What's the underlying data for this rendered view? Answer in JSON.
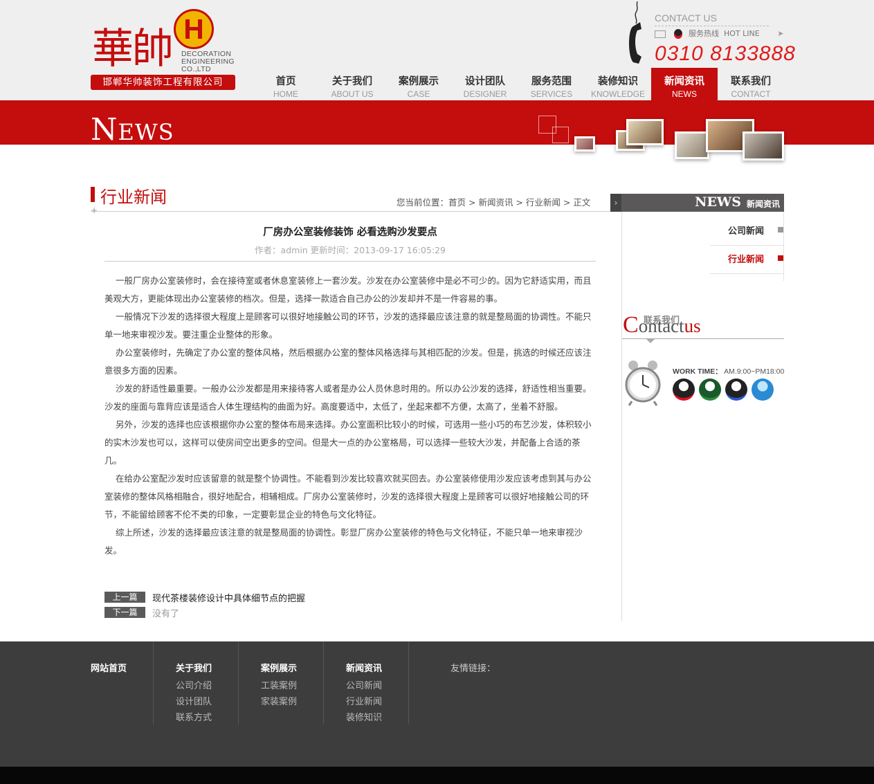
{
  "header": {
    "logo_char": "華帥",
    "logo_en": [
      "DECORATION",
      "ENGINEERING",
      "CO.,LTD"
    ],
    "company_name": "邯郸华帅装饰工程有限公司",
    "contact_label": "CONTACT",
    "contact_label_suffix": "US",
    "hotline_cn": "服务热线",
    "hotline_en": "HOT LINE",
    "phone": "0310 8133888"
  },
  "nav": [
    {
      "cn": "首页",
      "en": "HOME"
    },
    {
      "cn": "关于我们",
      "en": "ABOUT US"
    },
    {
      "cn": "案例展示",
      "en": "CASE"
    },
    {
      "cn": "设计团队",
      "en": "DESIGNER"
    },
    {
      "cn": "服务范围",
      "en": "SERVICES"
    },
    {
      "cn": "装修知识",
      "en": "KNOWLEDGE"
    },
    {
      "cn": "新闻资讯",
      "en": "NEWS",
      "active": true
    },
    {
      "cn": "联系我们",
      "en": "CONTACT"
    }
  ],
  "banner": {
    "title_big": "N",
    "title_rest": "EWS"
  },
  "section": {
    "title": "行业新闻",
    "breadcrumb_prefix": "您当前位置：",
    "breadcrumb": [
      "首页",
      "新闻资讯",
      "行业新闻",
      "正文"
    ]
  },
  "article": {
    "title": "厂房办公室装修装饰 必看选购沙发要点",
    "meta": "作者：admin   更新时间：2013-09-17 16:05:29",
    "paragraphs": [
      "一般厂房办公室装修时，会在接待室或者休息室装修上一套沙发。沙发在办公室装修中是必不可少的。因为它舒适实用，而且美观大方，更能体现出办公室装修的档次。但是，选择一款适合自己办公的沙发却并不是一件容易的事。",
      "一般情况下沙发的选择很大程度上是顾客可以很好地接触公司的环节，沙发的选择最应该注意的就是整局面的协调性。不能只单一地来审视沙发。要注重企业整体的形象。",
      "办公室装修时，先确定了办公室的整体风格，然后根据办公室的整体风格选择与其相匹配的沙发。但是，挑选的时候还应该注意很多方面的因素。",
      "沙发的舒适性最重要。一般办公沙发都是用来接待客人或者是办公人员休息时用的。所以办公沙发的选择，舒适性相当重要。沙发的座面与靠背应该是适合人体生理结构的曲面为好。高度要适中，太低了，坐起来都不方便，太高了，坐着不舒服。",
      "另外，沙发的选择也应该根据你办公室的整体布局来选择。办公室面积比较小的时候，可选用一些小巧的布艺沙发，体积较小的实木沙发也可以，这样可以使房间空出更多的空间。但是大一点的办公室格局，可以选择一些较大沙发，并配备上合适的茶几。",
      "在给办公室配沙发时应该留意的就是整个协调性。不能看到沙发比较喜欢就买回去。办公室装修使用沙发应该考虑到其与办公室装修的整体风格相融合，很好地配合，相辅相成。厂房办公室装修时，沙发的选择很大程度上是顾客可以很好地接触公司的环节，不能留给顾客不伦不类的印象，一定要彰显企业的特色与文化特征。",
      "综上所述，沙发的选择最应该注意的就是整局面的协调性。彰显厂房办公室装修的特色与文化特征，不能只单一地来审视沙发。"
    ],
    "prev_label": "上一篇",
    "prev_title": "现代茶楼装修设计中具体细节点的把握",
    "next_label": "下一篇",
    "next_title": "没有了"
  },
  "sidebar": {
    "news_en": "NEWS",
    "news_cn": "新闻资讯",
    "items": [
      {
        "label": "公司新闻"
      },
      {
        "label": "行业新闻",
        "active": true
      }
    ],
    "contact_cn": "联系我们",
    "contact_en_a": "C",
    "contact_en_b": "ontact",
    "contact_en_c": "us",
    "work_time_label": "WORK TIME：",
    "work_time": "AM.9:00~PM18:00"
  },
  "footer": {
    "cols": [
      {
        "head": "网站首页",
        "links": []
      },
      {
        "head": "关于我们",
        "links": [
          "公司介绍",
          "设计团队",
          "联系方式"
        ]
      },
      {
        "head": "案例展示",
        "links": [
          "工装案例",
          "家装案例"
        ]
      },
      {
        "head": "新闻资讯",
        "links": [
          "公司新闻",
          "行业新闻",
          "装修知识"
        ]
      }
    ],
    "friend_links": "友情链接："
  },
  "colors": {
    "brand_red": "#c40d0d",
    "footer": "#3d3d3d"
  }
}
